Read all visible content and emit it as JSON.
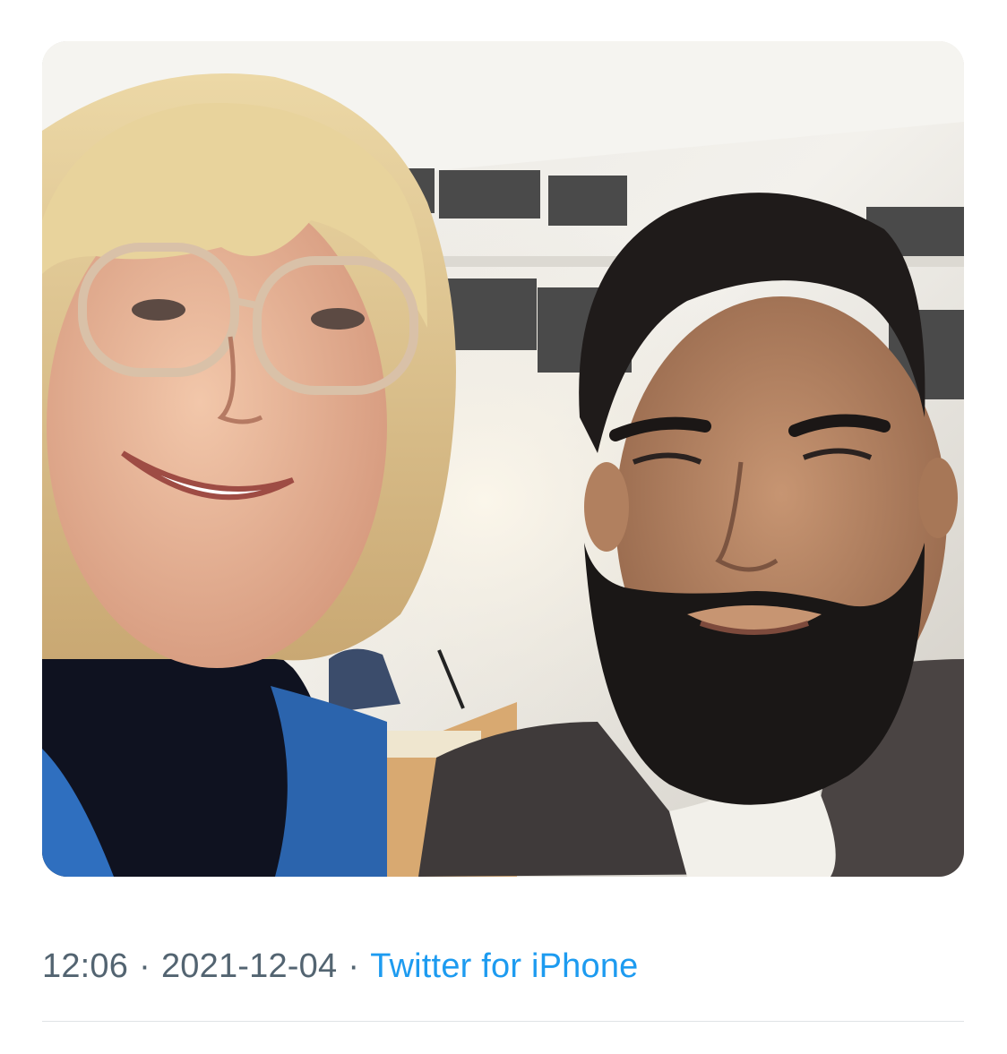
{
  "tweet": {
    "media": {
      "icon": "photo"
    },
    "meta": {
      "time": "12:06",
      "separator": "·",
      "date": "2021-12-04",
      "source": "Twitter for iPhone"
    }
  },
  "colors": {
    "meta_text": "#536471",
    "link": "#1d9bf0",
    "divider": "#dfe3e6"
  }
}
